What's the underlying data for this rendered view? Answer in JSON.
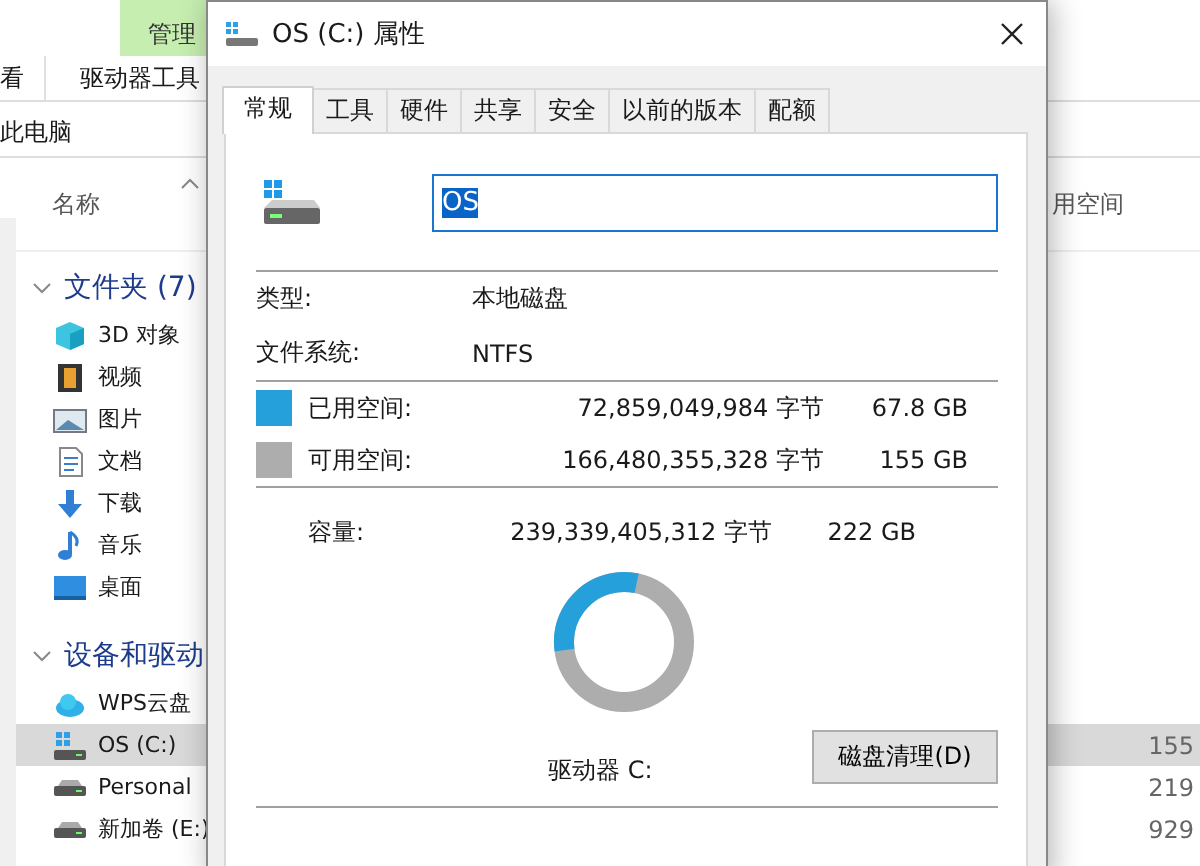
{
  "explorer": {
    "context_tab": "管理",
    "ribbon_tabs": [
      "看",
      "驱动器工具"
    ],
    "address": "此电脑",
    "column_headers": [
      "名称",
      "用空间"
    ],
    "nav": [
      {
        "kind": "group",
        "label": "文件夹 (7)",
        "expanded": true
      },
      {
        "kind": "item",
        "label": "3D 对象",
        "selected": false
      },
      {
        "kind": "item",
        "label": "视频",
        "selected": false
      },
      {
        "kind": "item",
        "label": "图片",
        "selected": false
      },
      {
        "kind": "item",
        "label": "文档",
        "selected": false
      },
      {
        "kind": "item",
        "label": "下载",
        "selected": false
      },
      {
        "kind": "item",
        "label": "音乐",
        "selected": false
      },
      {
        "kind": "item",
        "label": "桌面",
        "selected": false
      },
      {
        "kind": "group",
        "label": "设备和驱动",
        "expanded": true
      },
      {
        "kind": "item",
        "label": "WPS云盘",
        "selected": false
      },
      {
        "kind": "item",
        "label": "OS (C:)",
        "selected": true,
        "size": "155"
      },
      {
        "kind": "item",
        "label": "Personal",
        "selected": false,
        "size": "219"
      },
      {
        "kind": "item",
        "label": "新加卷 (E:)",
        "selected": false,
        "size": "929"
      }
    ]
  },
  "dialog": {
    "title": "OS (C:) 属性",
    "tabs": [
      {
        "label": "常规",
        "selected": true
      },
      {
        "label": "工具",
        "selected": false
      },
      {
        "label": "硬件",
        "selected": false
      },
      {
        "label": "共享",
        "selected": false
      },
      {
        "label": "安全",
        "selected": false
      },
      {
        "label": "以前的版本",
        "selected": false
      },
      {
        "label": "配额",
        "selected": false
      }
    ],
    "name_field": {
      "value": "OS",
      "text_selected": true
    },
    "properties": [
      {
        "label": "类型:",
        "value": "本地磁盘"
      },
      {
        "label": "文件系统:",
        "value": "NTFS"
      }
    ],
    "space": [
      {
        "label": "已用空间:",
        "bytes": "72,859,049,984 字节",
        "size": "67.8 GB",
        "color": "#26a0da"
      },
      {
        "label": "可用空间:",
        "bytes": "166,480,355,328 字节",
        "size": "155 GB",
        "color": "#adadad"
      }
    ],
    "capacity": {
      "label": "容量:",
      "bytes": "239,339,405,312 字节",
      "size": "222 GB"
    },
    "disk_usage": {
      "level": 0.305
    },
    "drive_label": "驱动器 C:",
    "cleanup_button": "磁盘清理(D)"
  }
}
